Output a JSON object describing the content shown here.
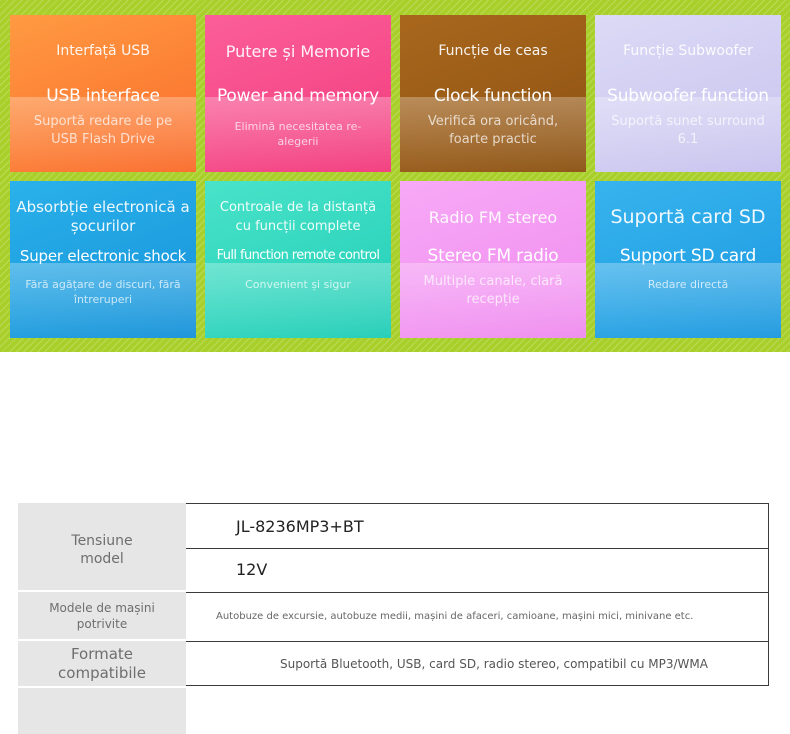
{
  "features": [
    {
      "ro": "Interfață USB",
      "en": "USB interface",
      "desc": "Suportă redare de pe USB Flash Drive"
    },
    {
      "ro": "Putere și Memorie",
      "en": "Power and memory",
      "desc": "Elimină necesitatea re-alegerii"
    },
    {
      "ro": "Funcție de ceas",
      "en": "Clock function",
      "desc": "Verifică ora oricând, foarte practic"
    },
    {
      "ro": "Funcție Subwoofer",
      "en": "Subwoofer function",
      "desc": "Suportă sunet surround 6.1"
    },
    {
      "ro": "Absorbție electronică a șocurilor",
      "en": "Super electronic shock",
      "desc": "Fără agățare de discuri, fără întreruperi"
    },
    {
      "ro": "Controale de la distanță cu funcții complete",
      "en": "Full function remote control",
      "desc": "Convenient și sigur"
    },
    {
      "ro": "Radio FM stereo",
      "en": "Stereo FM radio",
      "desc": "Multiple canale, clară recepție"
    },
    {
      "ro": "Suportă card SD",
      "en": "Support SD card",
      "desc": "Redare directă"
    }
  ],
  "specs": {
    "label_voltage_model": "Tensiune model",
    "model": "JL-8236MP3+BT",
    "voltage": "12V",
    "label_vehicles": "Modele de mașini potrivite",
    "vehicles": "Autobuze de excursie, autobuze medii, mașini de afaceri, camioane, mașini mici, minivane etc.",
    "label_formats": "Formate compatibile",
    "formats": "Suportă Bluetooth, USB, card SD, radio stereo, compatibil cu MP3/WMA"
  }
}
